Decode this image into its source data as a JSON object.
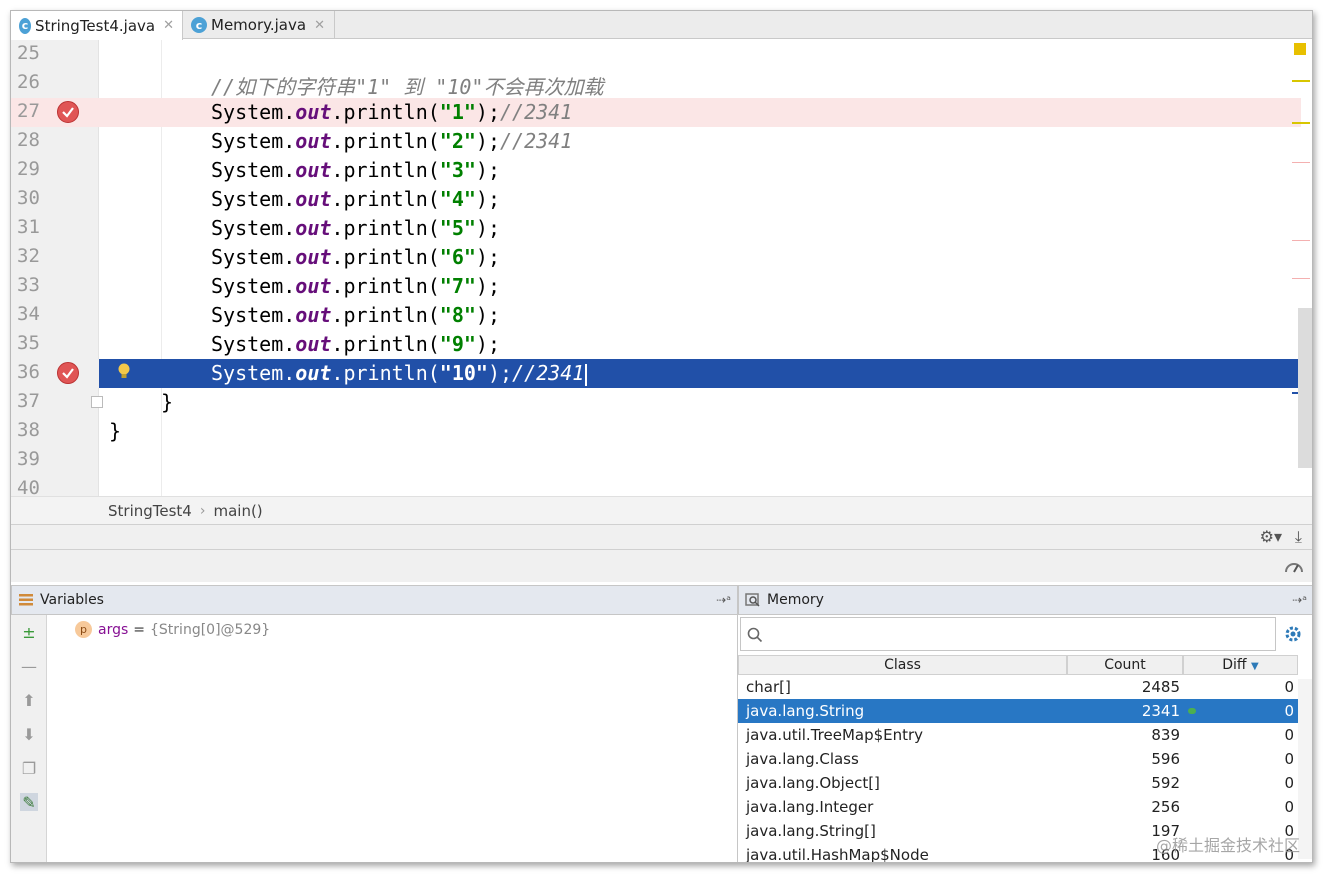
{
  "tabs": [
    {
      "label": "StringTest4.java",
      "icon": "java-class-icon",
      "active": true
    },
    {
      "label": "Memory.java",
      "icon": "java-class-icon",
      "active": false
    }
  ],
  "editor": {
    "lines": [
      {
        "num": "25"
      },
      {
        "num": "26",
        "comment": "//如下的字符串\"1\" 到 \"10\"不会再次加载"
      },
      {
        "num": "27",
        "prefix": "System.",
        "field": "out",
        "call": ".println(",
        "arg": "\"1\"",
        "end": ");",
        "comment": "//2341"
      },
      {
        "num": "28",
        "prefix": "System.",
        "field": "out",
        "call": ".println(",
        "arg": "\"2\"",
        "end": ");",
        "comment": "//2341"
      },
      {
        "num": "29",
        "prefix": "System.",
        "field": "out",
        "call": ".println(",
        "arg": "\"3\"",
        "end": ");"
      },
      {
        "num": "30",
        "prefix": "System.",
        "field": "out",
        "call": ".println(",
        "arg": "\"4\"",
        "end": ");"
      },
      {
        "num": "31",
        "prefix": "System.",
        "field": "out",
        "call": ".println(",
        "arg": "\"5\"",
        "end": ");"
      },
      {
        "num": "32",
        "prefix": "System.",
        "field": "out",
        "call": ".println(",
        "arg": "\"6\"",
        "end": ");"
      },
      {
        "num": "33",
        "prefix": "System.",
        "field": "out",
        "call": ".println(",
        "arg": "\"7\"",
        "end": ");"
      },
      {
        "num": "34",
        "prefix": "System.",
        "field": "out",
        "call": ".println(",
        "arg": "\"8\"",
        "end": ");"
      },
      {
        "num": "35",
        "prefix": "System.",
        "field": "out",
        "call": ".println(",
        "arg": "\"9\"",
        "end": ");"
      },
      {
        "num": "36",
        "prefix": "System.",
        "field": "out",
        "call": ".println(",
        "arg": "\"10\"",
        "end": ");",
        "comment": "//2341"
      },
      {
        "num": "37",
        "brace": "}"
      },
      {
        "num": "38",
        "brace": "}"
      },
      {
        "num": "39"
      },
      {
        "num": "40"
      }
    ]
  },
  "breadcrumb": {
    "class": "StringTest4",
    "separator": "›",
    "method": "main()"
  },
  "variables": {
    "title": "Variables",
    "pin": "⇢ᵃ",
    "items": [
      {
        "badge": "p",
        "name": "args",
        "eq": "=",
        "value": "{String[0]@529}"
      }
    ]
  },
  "memory": {
    "title": "Memory",
    "pin": "⇢ᵃ",
    "search_value": "",
    "columns": {
      "class": "Class",
      "count": "Count",
      "diff": "Diff"
    },
    "rows": [
      {
        "class": "char[]",
        "count": "2485",
        "diff": "0"
      },
      {
        "class": "java.lang.String",
        "count": "2341",
        "diff": "0",
        "selected": true
      },
      {
        "class": "java.util.TreeMap$Entry",
        "count": "839",
        "diff": "0"
      },
      {
        "class": "java.lang.Class",
        "count": "596",
        "diff": "0"
      },
      {
        "class": "java.lang.Object[]",
        "count": "592",
        "diff": "0"
      },
      {
        "class": "java.lang.Integer",
        "count": "256",
        "diff": "0"
      },
      {
        "class": "java.lang.String[]",
        "count": "197",
        "diff": "0"
      },
      {
        "class": "java.util.HashMap$Node",
        "count": "160",
        "diff": "0"
      }
    ]
  },
  "watermark": "@稀土掘金技术社区",
  "colors": {
    "exec_line": "#2150a8",
    "breakpoint_line": "#fbe6e6",
    "selected_row": "#2877c4"
  }
}
